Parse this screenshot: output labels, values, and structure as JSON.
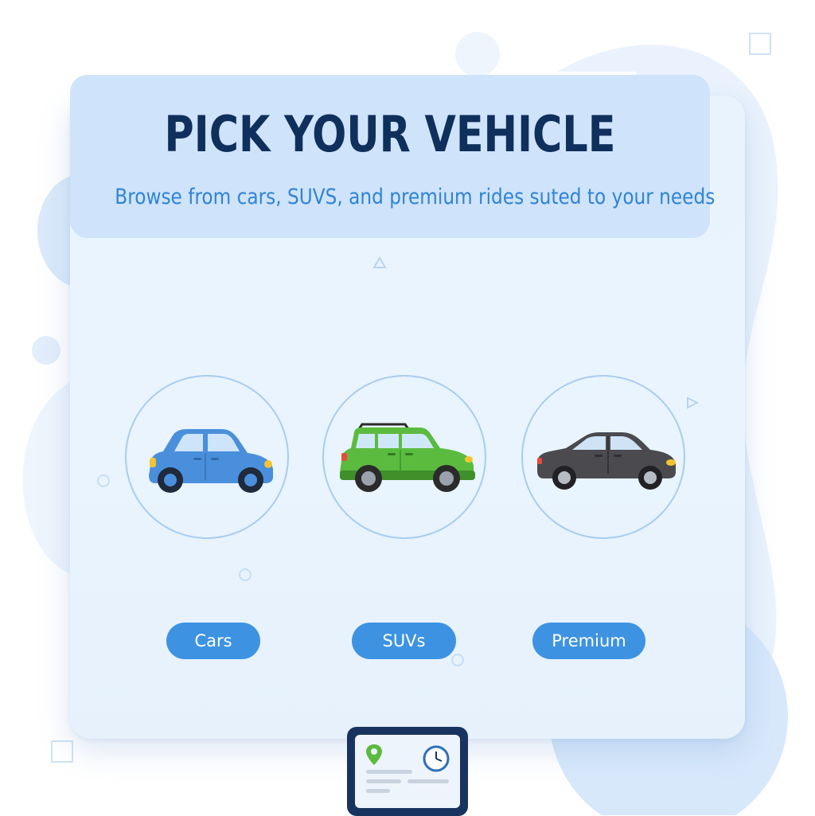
{
  "header": {
    "title": "PICK YOUR VEHICLE",
    "subtitle": "Browse from cars, SUVS, and premium rides suted to your needs"
  },
  "categories": [
    {
      "label": "Cars",
      "icon": "hatchback-car-icon",
      "color": "#4a8fdb"
    },
    {
      "label": "SUVs",
      "icon": "suv-icon",
      "color": "#5bbb3f"
    },
    {
      "label": "Premium",
      "icon": "sedan-car-icon",
      "color": "#4a4a4f"
    }
  ],
  "colors": {
    "title": "#0f2f5c",
    "subtitle": "#2f84d6",
    "pill": "#3d93e2",
    "header_panel": "#cfe3fa",
    "card": "#e8f3fd"
  },
  "footer_device": {
    "icons": [
      "map-pin-icon",
      "clock-icon"
    ]
  }
}
